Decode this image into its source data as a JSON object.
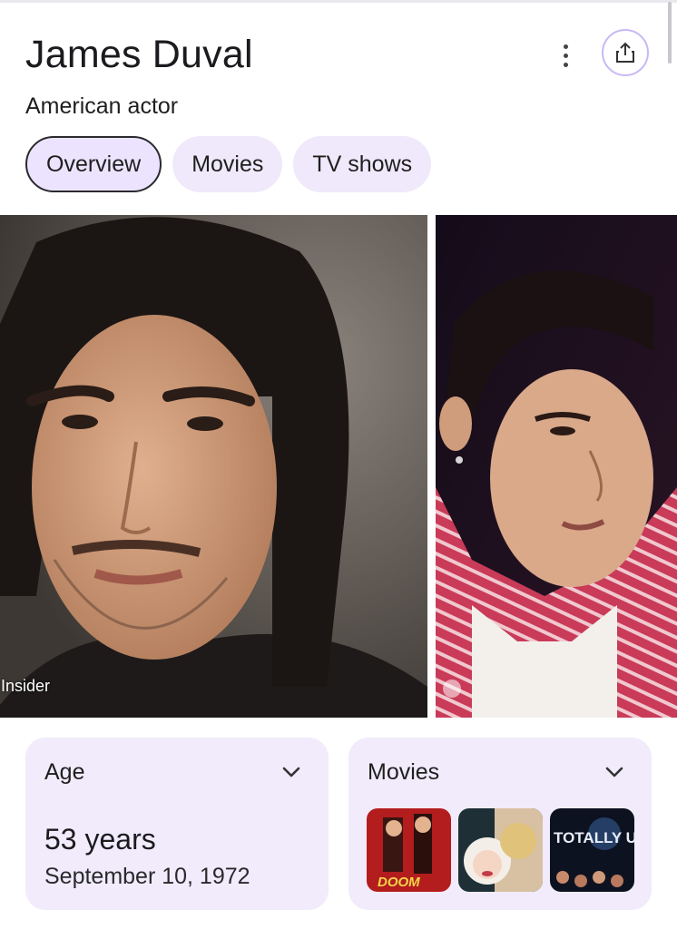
{
  "header": {
    "title": "James Duval",
    "subtitle": "American actor",
    "menu_icon": "more-vert-icon",
    "share_icon": "share-icon"
  },
  "tabs": [
    {
      "label": "Overview",
      "active": true
    },
    {
      "label": "Movies",
      "active": false
    },
    {
      "label": "TV shows",
      "active": false
    }
  ],
  "images": [
    {
      "source_label": "Insider",
      "description": "portrait photo"
    },
    {
      "source_label": "",
      "description": "portrait photo"
    }
  ],
  "cards": {
    "age": {
      "heading": "Age",
      "value": "53 years",
      "detail": "September 10, 1972"
    },
    "movies": {
      "heading": "Movies",
      "thumb_text": [
        "DOOM",
        "",
        "TOTALLY UP"
      ]
    }
  },
  "colors": {
    "accent_light": "#efe9fb",
    "accent_border": "#c9b8f5",
    "card_bg": "#f1ebfb"
  }
}
